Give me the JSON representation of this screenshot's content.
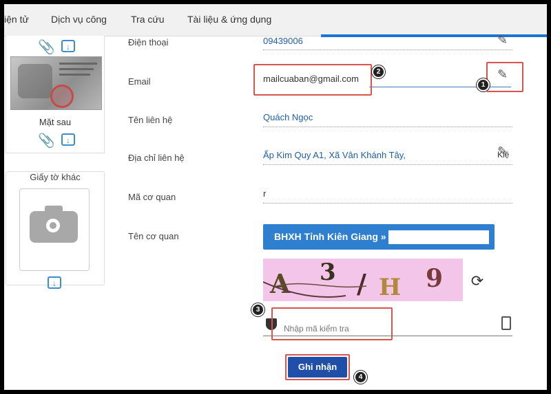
{
  "nav": {
    "items": [
      "iện tử",
      "Dịch vụ công",
      "Tra cứu",
      "Tài liệu & ứng dụng"
    ]
  },
  "sidebar": {
    "back_label": "Mặt sau",
    "other_docs_label": "Giấy tờ khác"
  },
  "form": {
    "fields": [
      {
        "label": "Điện thoại",
        "value": "09439006"
      },
      {
        "label": "Email",
        "value": "mailcuaban@gmail.com"
      },
      {
        "label": "Tên liên hệ",
        "value": "Quách Ngọc"
      },
      {
        "label": "Địa chỉ liên hệ",
        "value": "Ấp Kim Quy A1, Xã Vân Khánh Tây,",
        "suffix": "Kiệ"
      },
      {
        "label": "Mã cơ quan",
        "value": "r"
      },
      {
        "label": "Tên cơ quan",
        "value": "BHXH Tỉnh Kiên Giang »"
      }
    ]
  },
  "captcha": {
    "chars": [
      "A",
      "3",
      "/",
      "H",
      "9"
    ],
    "placeholder": "Nhập mã kiểm tra"
  },
  "submit_label": "Ghi nhận",
  "annotations": {
    "badges": [
      "1",
      "2",
      "3",
      "4"
    ]
  },
  "colors": {
    "highlight": "#d9534f",
    "link_blue": "#1f5ea8",
    "button_blue": "#2e7fd0",
    "submit_blue": "#1f4fa8",
    "captcha_bg": "#f2c5e9",
    "attach_green": "#6ab86b"
  },
  "icons": [
    "paperclip-icon",
    "download-icon",
    "camera-icon",
    "edit-icon",
    "refresh-icon",
    "shield-icon",
    "phone-icon"
  ]
}
